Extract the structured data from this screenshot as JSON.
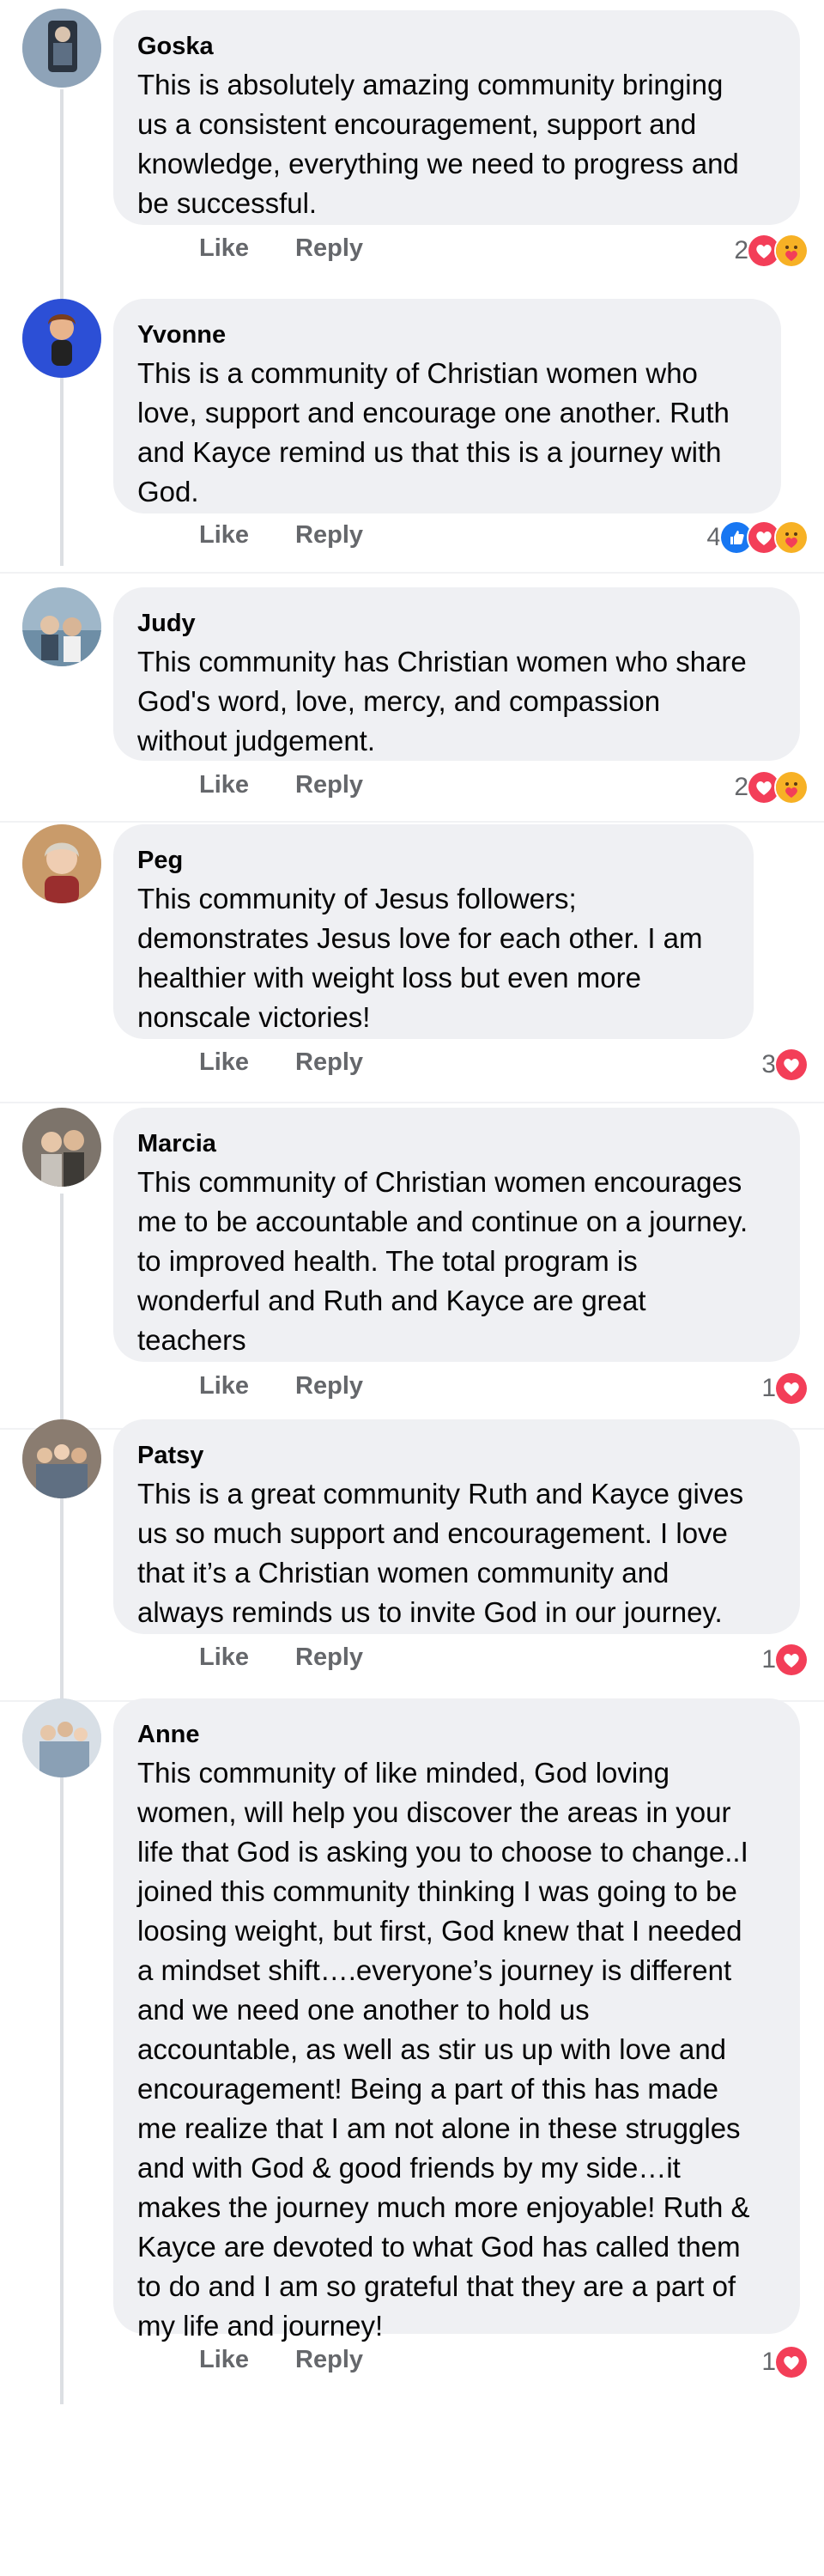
{
  "comments": [
    {
      "author": "Goska",
      "text": "This is absolutely amazing community bringing\nus a consistent encouragement, support and\nknowledge, everything we need to progress and\nbe successful.",
      "like_label": "Like",
      "reply_label": "Reply",
      "reaction_count": "2",
      "reactions": [
        "heart",
        "care"
      ],
      "avatar_color": "#8ea3b8"
    },
    {
      "author": "Yvonne",
      "text": "This is a community of Christian women who\nlove, support and encourage one another. Ruth\nand Kayce remind us that this is a journey with\nGod.",
      "like_label": "Like",
      "reply_label": "Reply",
      "reaction_count": "4",
      "reactions": [
        "like",
        "heart",
        "care"
      ],
      "avatar_color": "#2c4fd6"
    },
    {
      "author": "Judy",
      "text": "This community has Christian women who share\nGod's word,  love, mercy,  and compassion\nwithout judgement.",
      "like_label": "Like",
      "reply_label": "Reply",
      "reaction_count": "2",
      "reactions": [
        "heart",
        "care"
      ],
      "avatar_color": "#9fb7c9"
    },
    {
      "author": "Peg",
      "text": "This community of Jesus followers;\ndemonstrates Jesus love for each other. I am\nhealthier with weight loss but even more\nnonscale victories!",
      "like_label": "Like",
      "reply_label": "Reply",
      "reaction_count": "3",
      "reactions": [
        "heart"
      ],
      "avatar_color": "#c99b6a"
    },
    {
      "author": "Marcia",
      "text": "This community of Christian women encourages\nme to be accountable and continue on a journey.\nto improved health.  The total program is\nwonderful and Ruth and Kayce are great\nteachers",
      "like_label": "Like",
      "reply_label": "Reply",
      "reaction_count": "1",
      "reactions": [
        "heart"
      ],
      "avatar_color": "#7d746b"
    },
    {
      "author": "Patsy",
      "text": "This is a great community Ruth and Kayce  gives\nus so much support and encouragement. I love\nthat it’s a Christian women community and\nalways reminds us to invite God in our journey.",
      "like_label": "Like",
      "reply_label": "Reply",
      "reaction_count": "1",
      "reactions": [
        "heart"
      ],
      "avatar_color": "#8a7c70"
    },
    {
      "author": "Anne",
      "text": "This community of like minded, God loving\nwomen, will help you discover the areas in your\nlife that God is asking you to choose to change..I\njoined this community thinking I was going to be\nloosing weight, but first, God knew that I needed\na mindset shift….everyone’s journey is different\nand we need one another to hold us\naccountable, as well as stir us up with love and\nencouragement!  Being a part of this has made\nme realize that I am not alone in these struggles\nand with God & good friends by my side…it\nmakes the journey much more enjoyable! Ruth &\nKayce are devoted to what God has called them\nto do and I am so grateful that they are a part of\nmy life and journey!",
      "like_label": "Like",
      "reply_label": "Reply",
      "reaction_count": "1",
      "reactions": [
        "heart"
      ],
      "avatar_color": "#b9a48e"
    }
  ],
  "colors": {
    "bubble": "#eff0f3",
    "meta_text": "#65676b",
    "like_blue": "#1877f2",
    "heart_red": "#f33e58",
    "care_yellow": "#f7b125"
  }
}
